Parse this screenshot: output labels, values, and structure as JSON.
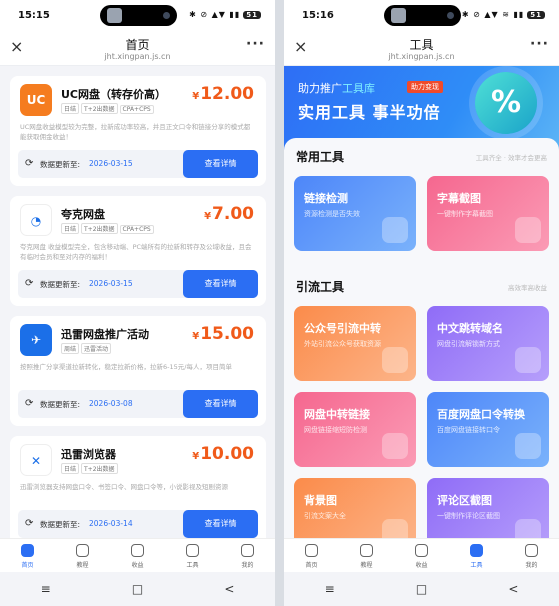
{
  "left_screen": {
    "status_time": "15:15",
    "status_icons": "✱ ⊘ ▲▼ ▮▮",
    "battery": "51",
    "title": "首页",
    "url": "jht.xingpan.js.cn",
    "close": "×",
    "more": "···",
    "cards": [
      {
        "name": "UC网盘（转存价高）",
        "tags": [
          "日结",
          "T+2出数据",
          "CPA+CPS"
        ],
        "currency": "¥",
        "price": "12.00",
        "desc": "UC网盘收益模型较为完整，拉新成功率较高，并且正文口令和链接分享的模式都能获取佣金收益！",
        "update_label": "数据更新至:",
        "update_date": "2026-03-15",
        "button": "查看详情",
        "logo_color": "#f57c1f",
        "logo_glyph": "UC"
      },
      {
        "name": "夸克网盘",
        "tags": [
          "日结",
          "T+2出数据",
          "CPA+CPS"
        ],
        "currency": "¥",
        "price": "7.00",
        "desc": "夸克网盘 收益模型完全，包含移动端、PC端所有的拉新和转存及公域收益，且会有临时会员和至对内存的福利！",
        "update_label": "数据更新至:",
        "update_date": "2026-03-15",
        "button": "查看详情",
        "logo_color": "#ffffff",
        "logo_glyph": "◔"
      },
      {
        "name": "迅雷网盘推广活动",
        "tags": [
          "周结",
          "迅雷活动"
        ],
        "currency": "¥",
        "price": "15.00",
        "desc": "按照推广分享渠道拉新转化，稳定拉新价格，拉新6-15元/每人，项目简单",
        "update_label": "数据更新至:",
        "update_date": "2026-03-08",
        "button": "查看详情",
        "logo_color": "#1b6fe8",
        "logo_glyph": "✈"
      },
      {
        "name": "迅雷浏览器",
        "tags": [
          "日结",
          "T+2出数据"
        ],
        "currency": "¥",
        "price": "10.00",
        "desc": "迅雷浏览器支持网盘口令、书签口令、网盘口令等，小说影视及短剧资源",
        "update_label": "数据更新至:",
        "update_date": "2026-03-14",
        "button": "查看详情",
        "logo_color": "#ffffff",
        "logo_glyph": "✕"
      }
    ],
    "tabs": [
      {
        "label": "首页",
        "icon": "home-icon"
      },
      {
        "label": "教程",
        "icon": "graduation-icon"
      },
      {
        "label": "收益",
        "icon": "chart-icon"
      },
      {
        "label": "工具",
        "icon": "cube-icon"
      },
      {
        "label": "我的",
        "icon": "user-icon"
      }
    ],
    "active_tab": 0,
    "nav": [
      "≡",
      "□",
      "<"
    ]
  },
  "right_screen": {
    "status_time": "15:16",
    "status_icons": "✱ ⊘ ▲▼ ≋ ▮▮",
    "battery": "51",
    "title": "工具",
    "url": "jht.xingpan.js.cn",
    "close": "×",
    "more": "···",
    "banner": {
      "prefix": "助力推广",
      "highlight": "工具库",
      "badge": "助力变现",
      "headline": "实用工具  事半功倍",
      "symbol": "%"
    },
    "section1": {
      "title": "常用工具",
      "hint": "工具齐全 · 效率才会更高"
    },
    "section2": {
      "title": "引流工具",
      "hint": "高效率高收益"
    },
    "tools_common": [
      {
        "title": "链接检测",
        "desc": "资源检测是否失效",
        "color": "blue"
      },
      {
        "title": "字幕截图",
        "desc": "一键制作字幕截图",
        "color": "pink"
      }
    ],
    "tools_traffic": [
      {
        "title": "公众号引流中转",
        "desc": "外站引流公众号获取资源",
        "color": "orange"
      },
      {
        "title": "中文跳转域名",
        "desc": "网盘引流解锁新方式",
        "color": "purple"
      },
      {
        "title": "网盘中转链接",
        "desc": "网盘链接缩短防检测",
        "color": "pink"
      },
      {
        "title": "百度网盘口令转换",
        "desc": "百度网盘链接转口令",
        "color": "blue"
      },
      {
        "title": "背景图",
        "desc": "引流文案大全",
        "color": "orange"
      },
      {
        "title": "评论区截图",
        "desc": "一键制作评论区截图",
        "color": "purple"
      }
    ],
    "tabs": [
      {
        "label": "首页",
        "icon": "home-icon"
      },
      {
        "label": "教程",
        "icon": "graduation-icon"
      },
      {
        "label": "收益",
        "icon": "chart-icon"
      },
      {
        "label": "工具",
        "icon": "cube-icon"
      },
      {
        "label": "我的",
        "icon": "user-icon"
      }
    ],
    "active_tab": 3,
    "nav": [
      "≡",
      "□",
      "<"
    ]
  },
  "colors": {
    "accent": "#2b6ef3",
    "price": "#f05a1a"
  }
}
